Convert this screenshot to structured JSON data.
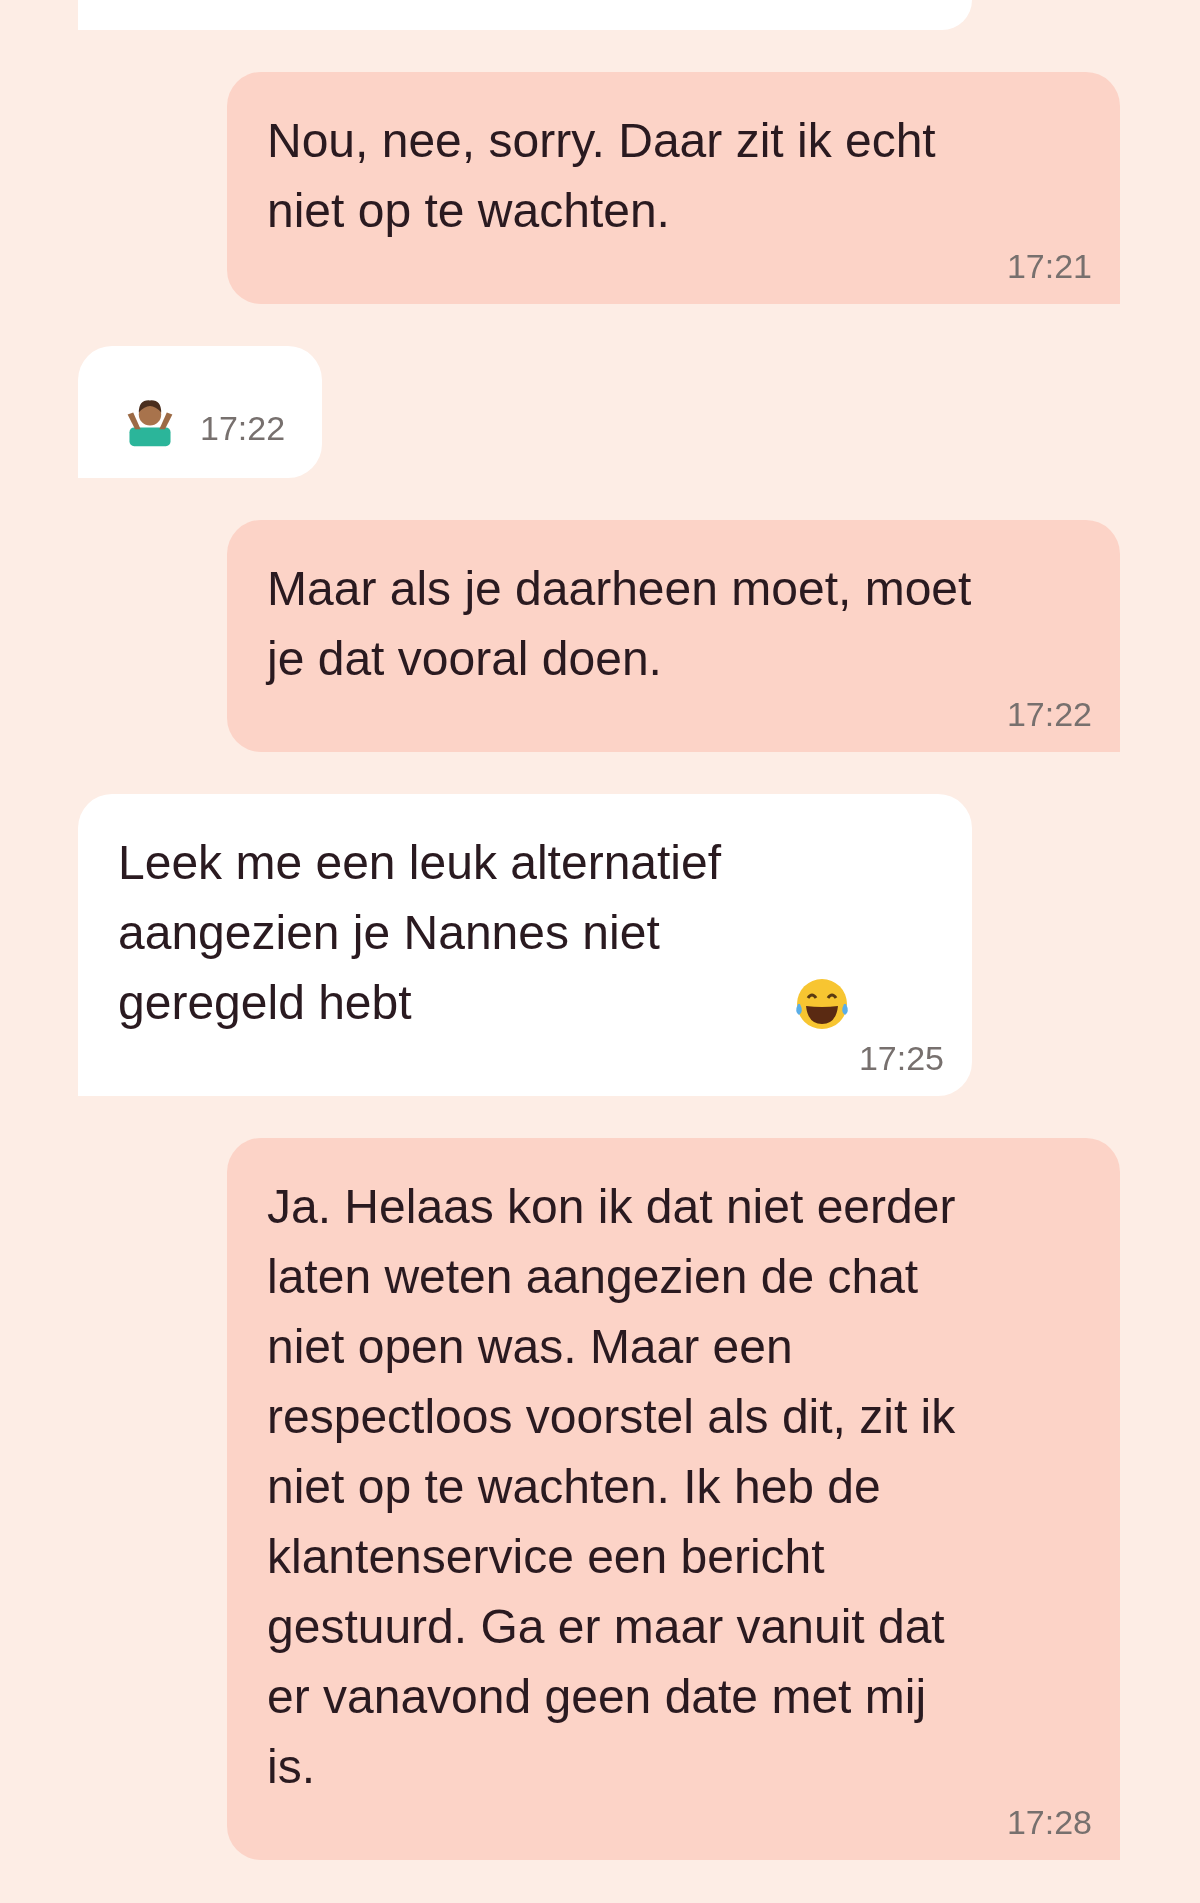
{
  "messages": [
    {
      "kind": "cut",
      "sent": false
    },
    {
      "kind": "text",
      "sent": true,
      "text": "Nou, nee, sorry. Daar zit ik echt niet op te wachten.",
      "time": "17:21"
    },
    {
      "kind": "emoji",
      "sent": false,
      "time": "17:22"
    },
    {
      "kind": "text",
      "sent": true,
      "text": "Maar als je daarheen moet, moet je dat vooral doen.",
      "time": "17:22"
    },
    {
      "kind": "text",
      "sent": false,
      "text": "Leek me een leuk alternatief aangezien je Nannes niet geregeld hebt",
      "trailing_emoji": true,
      "time": "17:25"
    },
    {
      "kind": "text",
      "sent": true,
      "text": "Ja. Helaas kon ik dat niet eerder laten weten aangezien de chat niet open was. Maar een respectloos voorstel als dit, zit ik niet op te wachten. Ik heb de klantenservice een bericht gestuurd. Ga er maar vanuit dat er vanavond geen date met mij is.",
      "time": "17:28"
    }
  ]
}
